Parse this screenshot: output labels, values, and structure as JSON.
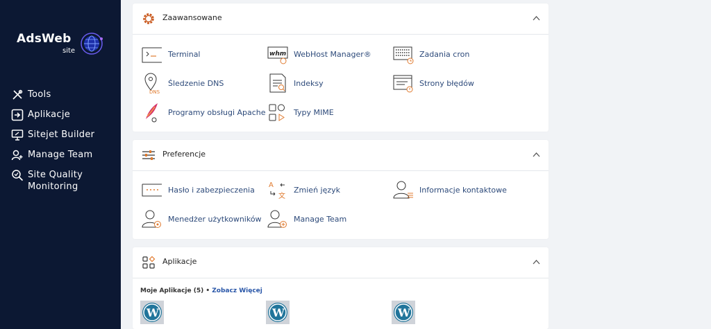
{
  "brand": {
    "name": "AdsWeb",
    "sub": "site"
  },
  "sidebar": {
    "items": [
      {
        "label": "Tools",
        "icon": "tools-icon"
      },
      {
        "label": "Aplikacje",
        "icon": "apps-icon"
      },
      {
        "label": "Sitejet Builder",
        "icon": "sitejet-icon"
      },
      {
        "label": "Manage Team",
        "icon": "team-icon"
      },
      {
        "label": "Site Quality Monitoring",
        "icon": "site-quality-icon"
      }
    ]
  },
  "panels": {
    "advanced": {
      "title": "Zaawansowane",
      "items": [
        {
          "label": "Terminal",
          "icon": "terminal-icon"
        },
        {
          "label": "WebHost Manager®",
          "icon": "whm-icon"
        },
        {
          "label": "Zadania cron",
          "icon": "cron-icon"
        },
        {
          "label": "Śledzenie DNS",
          "icon": "dns-icon"
        },
        {
          "label": "Indeksy",
          "icon": "indexes-icon"
        },
        {
          "label": "Strony błędów",
          "icon": "error-pages-icon"
        },
        {
          "label": "Programy obsługi Apache",
          "icon": "apache-icon"
        },
        {
          "label": "Typy MIME",
          "icon": "mime-icon"
        }
      ]
    },
    "preferences": {
      "title": "Preferencje",
      "items": [
        {
          "label": "Hasło i zabezpieczenia",
          "icon": "password-icon"
        },
        {
          "label": "Zmień język",
          "icon": "language-icon"
        },
        {
          "label": "Informacje kontaktowe",
          "icon": "contact-icon"
        },
        {
          "label": "Menedżer użytkowników",
          "icon": "user-manager-icon"
        },
        {
          "label": "Manage Team",
          "icon": "manage-team-icon"
        }
      ]
    },
    "apps": {
      "title": "Aplikacje",
      "my_apps": "Moje Aplikacje (5)",
      "separator": " • ",
      "see_more": "Zobacz Więcej"
    }
  },
  "colors": {
    "sidebar_bg": "#0c1833",
    "link": "#2d4a7a",
    "accent": "#e07a2e"
  }
}
